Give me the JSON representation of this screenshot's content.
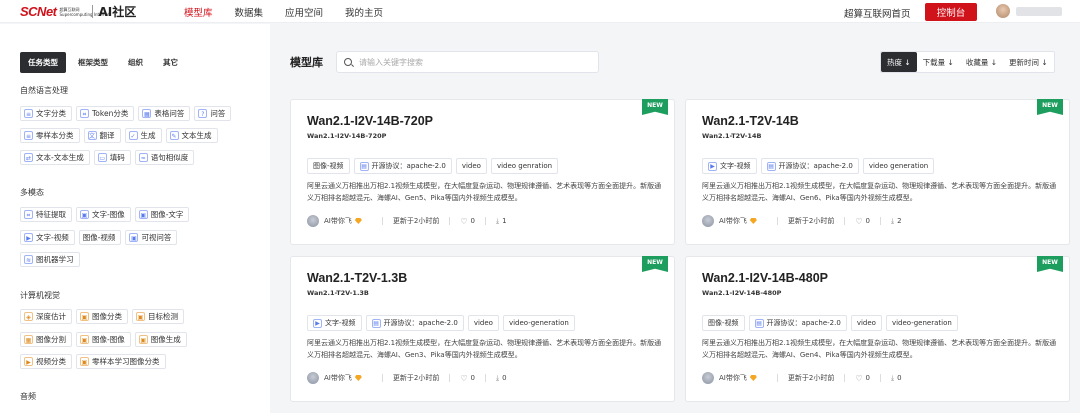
{
  "brand": {
    "logo": "SCNet",
    "sub_line1": "超算互联网",
    "sub_line2": "Supercomputing Internet",
    "section": "AI社区"
  },
  "nav": [
    "模型库",
    "数据集",
    "应用空间",
    "我的主页"
  ],
  "header": {
    "home_link": "超算互联网首页",
    "console": "控制台"
  },
  "sidebar": {
    "tabs": [
      "任务类型",
      "框架类型",
      "组织",
      "其它"
    ],
    "sections": [
      {
        "title": "自然语言处理",
        "rows": [
          [
            "文字分类",
            "Token分类",
            "表格问答",
            "问答"
          ],
          [
            "零样本分类",
            "翻译",
            "生成",
            "文本生成"
          ],
          [
            "文本-文本生成",
            "填码",
            "语句相似度"
          ]
        ]
      },
      {
        "title": "多模态",
        "rows": [
          [
            "特征提取",
            "文字-图像",
            "图像-文字"
          ],
          [
            "文字-视频",
            "图像-视频",
            "可视问答"
          ],
          [
            "图机器学习"
          ]
        ]
      },
      {
        "title": "计算机视觉",
        "rows": [
          [
            "深度估计",
            "图像分类",
            "目标检测"
          ],
          [
            "图像分割",
            "图像-图像",
            "图像生成"
          ],
          [
            "视频分类",
            "零样本学习图像分类"
          ]
        ]
      },
      {
        "title": "音频"
      }
    ]
  },
  "main": {
    "title": "模型库",
    "search_placeholder": "请输入关键字搜索",
    "sort": [
      "热度 ↓",
      "下载量 ↓",
      "收藏量 ↓",
      "更新时间 ↓"
    ]
  },
  "cards": [
    {
      "badge": "NEW",
      "title": "Wan2.1-I2V-14B-720P",
      "subtitle": "Wan2.1-I2V-14B-720P",
      "tags": [
        "图像-视频",
        "开源协议：apache-2.0",
        "video",
        "video genration"
      ],
      "desc": "阿里云通义万相推出万相2.1视频生成模型，在大幅度复杂运动、物理规律遵循、艺术表现等方面全面提升。新版通义万相排名超越混元、海螺AI、Gen5、Pika等国内外视频生成模型。",
      "author": "AI带你飞",
      "updated": "更新于2小时前",
      "likes": "0",
      "downloads": "1"
    },
    {
      "badge": "NEW",
      "title": "Wan2.1-T2V-14B",
      "subtitle": "Wan2.1-T2V-14B",
      "tags": [
        "文字-视频",
        "开源协议：apache-2.0",
        "video generation"
      ],
      "desc": "阿里云通义万相推出万相2.1视频生成模型，在大幅度复杂运动、物理规律遵循、艺术表现等方面全面提升。新版通义万相排名超越混元、海螺AI、Gen6、Pika等国内外视频生成模型。",
      "author": "AI带你飞",
      "updated": "更新于2小时前",
      "likes": "0",
      "downloads": "2"
    },
    {
      "badge": "NEW",
      "title": "Wan2.1-T2V-1.3B",
      "subtitle": "Wan2.1-T2V-1.3B",
      "tags": [
        "文字-视频",
        "开源协议：apache-2.0",
        "video",
        "video-generation"
      ],
      "desc": "阿里云通义万相推出万相2.1视频生成模型，在大幅度复杂运动、物理规律遵循、艺术表现等方面全面提升。新版通义万相排名超越混元、海螺AI、Gen3、Pika等国内外视频生成模型。",
      "author": "AI带你飞",
      "updated": "更新于2小时前",
      "likes": "0",
      "downloads": "0"
    },
    {
      "badge": "NEW",
      "title": "Wan2.1-I2V-14B-480P",
      "subtitle": "Wan2.1-I2V-14B-480P",
      "tags": [
        "图像-视频",
        "开源协议：apache-2.0",
        "video",
        "video-generation"
      ],
      "desc": "阿里云通义万相推出万相2.1视频生成模型，在大幅度复杂运动、物理规律遵循、艺术表现等方面全面提升。新版通义万相排名超越混元、海螺AI、Gen4、Pika等国内外视频生成模型。",
      "author": "AI带你飞",
      "updated": "更新于2小时前",
      "likes": "0",
      "downloads": "0"
    }
  ],
  "colors": {
    "brand_red": "#d0121b",
    "new_badge": "#1e9e5e",
    "dark_button": "#2b2d30"
  }
}
